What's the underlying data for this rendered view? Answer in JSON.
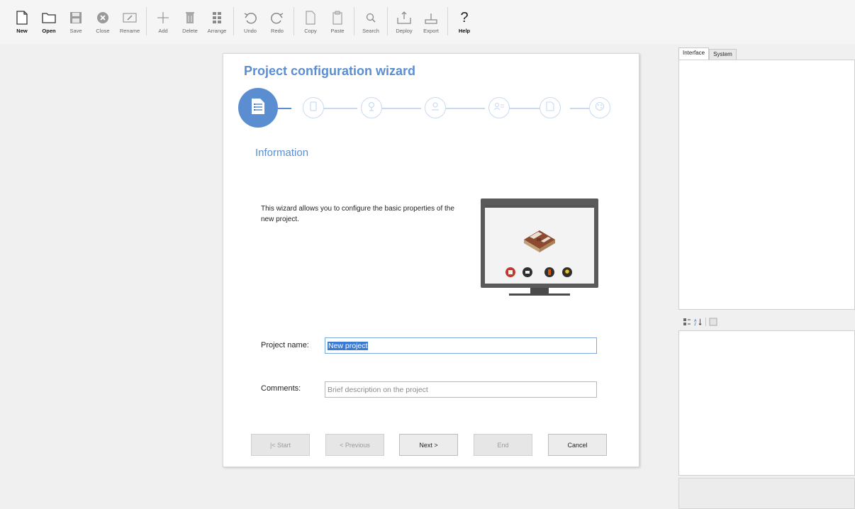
{
  "toolbar": {
    "items": [
      {
        "label": "New",
        "icon": "new-file-icon",
        "enabled": true
      },
      {
        "label": "Open",
        "icon": "folder-icon",
        "enabled": true
      },
      {
        "label": "Save",
        "icon": "save-icon",
        "enabled": false
      },
      {
        "label": "Close",
        "icon": "close-circle-icon",
        "enabled": false
      },
      {
        "label": "Rename",
        "icon": "rename-icon",
        "enabled": false
      },
      {
        "label": "Add",
        "icon": "plus-icon",
        "enabled": false
      },
      {
        "label": "Delete",
        "icon": "trash-icon",
        "enabled": false
      },
      {
        "label": "Arrange",
        "icon": "grid-icon",
        "enabled": false
      },
      {
        "label": "Undo",
        "icon": "undo-icon",
        "enabled": false
      },
      {
        "label": "Redo",
        "icon": "redo-icon",
        "enabled": false
      },
      {
        "label": "Copy",
        "icon": "copy-icon",
        "enabled": false
      },
      {
        "label": "Paste",
        "icon": "paste-icon",
        "enabled": false
      },
      {
        "label": "Search",
        "icon": "search-icon",
        "enabled": false
      },
      {
        "label": "Deploy",
        "icon": "deploy-icon",
        "enabled": false
      },
      {
        "label": "Export",
        "icon": "export-icon",
        "enabled": false
      },
      {
        "label": "Help",
        "icon": "help-icon",
        "enabled": true
      }
    ]
  },
  "wizard": {
    "title": "Project configuration wizard",
    "section_title": "Information",
    "intro": "This wizard allows you to configure the basic properties of the new project.",
    "steps": [
      {
        "icon": "document-icon",
        "active": true
      },
      {
        "icon": "tablet-icon",
        "active": false
      },
      {
        "icon": "location-pin-icon",
        "active": false
      },
      {
        "icon": "map-icon",
        "active": false
      },
      {
        "icon": "user-list-icon",
        "active": false
      },
      {
        "icon": "document-check-icon",
        "active": false
      },
      {
        "icon": "palette-icon",
        "active": false
      }
    ],
    "project_name_label": "Project name:",
    "project_name_value": "New project",
    "comments_label": "Comments:",
    "comments_placeholder": "Brief description on the project",
    "buttons": {
      "start": "|< Start",
      "previous": "< Previous",
      "next": "Next >",
      "end": "End",
      "cancel": "Cancel"
    },
    "accent_color": "#5b8ed0"
  },
  "right_panel": {
    "tabs": [
      "Interface",
      "System"
    ],
    "active_tab": "Interface"
  }
}
